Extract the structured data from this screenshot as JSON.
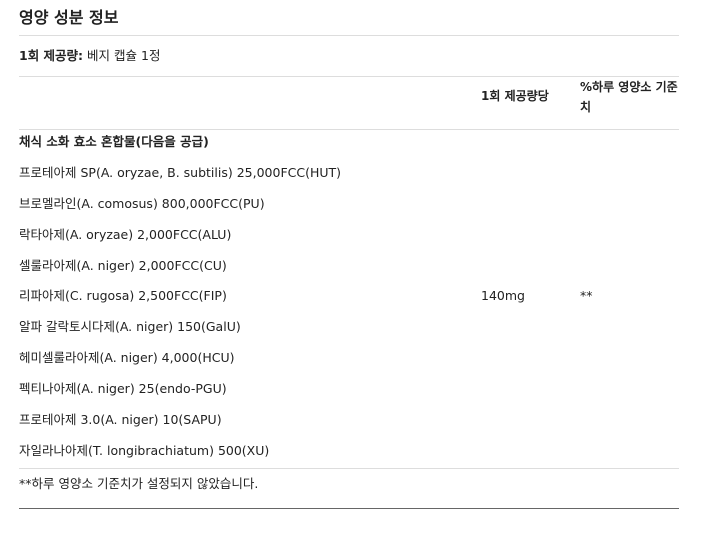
{
  "title": "영양 성분 정보",
  "serving": {
    "label": "1회 제공량:",
    "value": "베지 캡슐 1정"
  },
  "columns": {
    "amount_header": "1회 제공량당",
    "dv_header": "%하루 영양소 기준치"
  },
  "blend": {
    "title": "채식 소화 효소 혼합물(다음을 공급)",
    "ingredients": [
      "프로테아제 SP(A. oryzae, B. subtilis) 25,000FCC(HUT)",
      "브로멜라인(A. comosus) 800,000FCC(PU)",
      "락타아제(A. oryzae) 2,000FCC(ALU)",
      "셀룰라아제(A. niger) 2,000FCC(CU)",
      "리파아제(C. rugosa) 2,500FCC(FIP)",
      "알파 갈락토시다제(A. niger) 150(GalU)",
      "헤미셀룰라아제(A. niger) 4,000(HCU)",
      "펙티나아제(A. niger) 25(endo-PGU)",
      "프로테아제 3.0(A. niger) 10(SAPU)",
      "자일라나아제(T. longibrachiatum) 500(XU)"
    ],
    "amount": "140mg",
    "daily_value": "**"
  },
  "footnote": "**하루 영양소 기준치가 설정되지 않았습니다."
}
